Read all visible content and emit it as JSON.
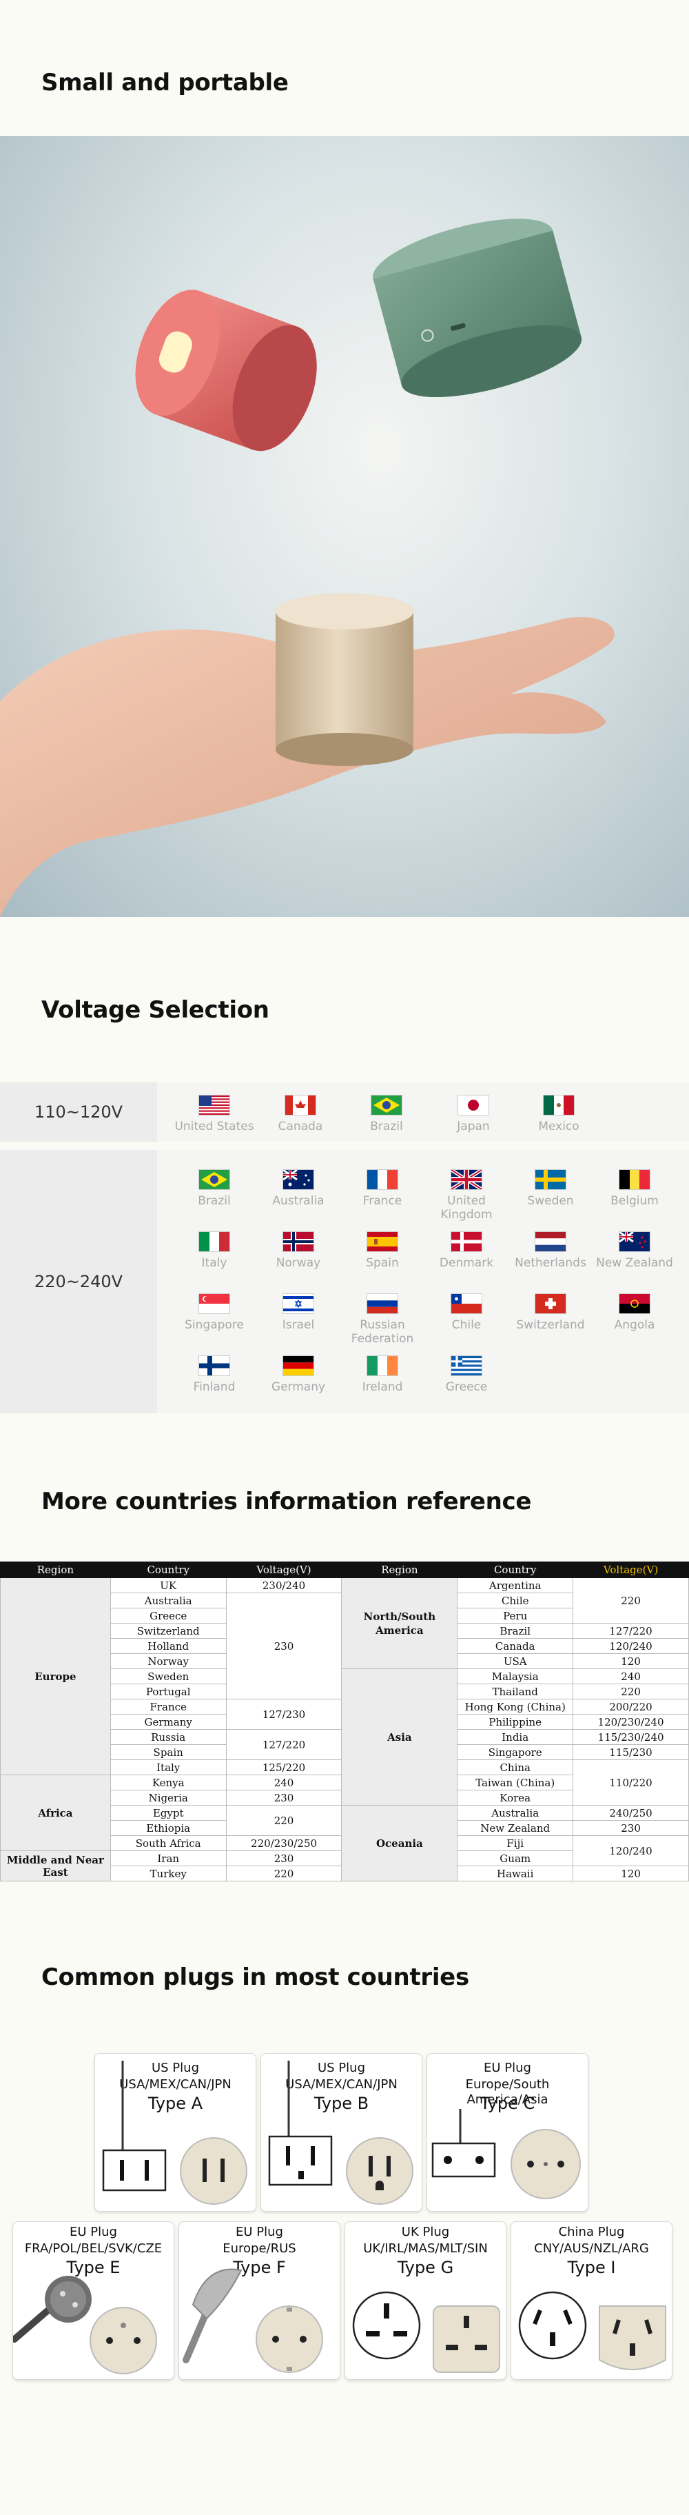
{
  "sections": {
    "portable_title": "Small and portable",
    "voltage_title": "Voltage Selection",
    "countries_title": "More countries information reference",
    "plugs_title": "Common plugs in most countries"
  },
  "voltage": {
    "row1": {
      "label": "110~120V",
      "countries": [
        "United States",
        "Canada",
        "Brazil",
        "Japan",
        "Mexico"
      ]
    },
    "row2": {
      "label": "220~240V",
      "countries": [
        [
          "Brazil",
          "Australia",
          "France",
          "United Kingdom",
          "Sweden",
          "Belgium"
        ],
        [
          "Italy",
          "Norway",
          "Spain",
          "Denmark",
          "Netherlands",
          "New Zealand"
        ],
        [
          "Singapore",
          "Israel",
          "Russian Federation",
          "Chile",
          "Switzerland",
          "Angola"
        ],
        [
          "Finland",
          "Germany",
          "Ireland",
          "Greece"
        ]
      ]
    }
  },
  "table": {
    "headers": [
      "Region",
      "Country",
      "Voltage(V)",
      "Region",
      "Country",
      "Voltage(V)"
    ],
    "left": {
      "europe": "Europe",
      "africa": "Africa",
      "middle_east": "Middle and Near East",
      "countries": [
        "UK",
        "Australia",
        "Greece",
        "Switzerland",
        "Holland",
        "Norway",
        "Sweden",
        "Portugal",
        "France",
        "Germany",
        "Russia",
        "Spain",
        "Italy",
        "Kenya",
        "Nigeria",
        "Egypt",
        "Ethiopia",
        "South Africa",
        "Iran",
        "Turkey"
      ],
      "voltages": {
        "uk": "230/240",
        "group1": "230",
        "group2": "127/230",
        "group3": "127/220",
        "italy": "125/220",
        "kenya": "240",
        "nigeria": "230",
        "group4": "220",
        "south_africa": "220/230/250",
        "iran": "230",
        "turkey": "220"
      }
    },
    "right": {
      "americas": "North/South America",
      "asia": "Asia",
      "oceania": "Oceania",
      "countries": [
        "Argentina",
        "Chile",
        "Peru",
        "Brazil",
        "Canada",
        "USA",
        "Malaysia",
        "Thailand",
        "Hong Kong (China)",
        "Philippine",
        "India",
        "Singapore",
        "China",
        "Taiwan (China)",
        "Korea",
        "Australia",
        "New Zealand",
        "Fiji",
        "Guam",
        "Hawaii"
      ],
      "voltages": {
        "group1": "220",
        "brazil": "127/220",
        "canada": "120/240",
        "usa": "120",
        "malaysia": "240",
        "thailand": "220",
        "hongkong": "200/220",
        "philippine": "120/230/240",
        "india": "115/230/240",
        "singapore": "115/230",
        "group2": "110/220",
        "australia": "240/250",
        "newzealand": "230",
        "group3": "120/240",
        "hawaii": "120"
      }
    }
  },
  "plugs": [
    {
      "line1": "US Plug",
      "line2": "USA/MEX/CAN/JPN",
      "type": "Type A"
    },
    {
      "line1": "US Plug",
      "line2": "USA/MEX/CAN/JPN",
      "type": "Type B"
    },
    {
      "line1": "EU Plug",
      "line2": "Europe/South America/Asia",
      "type": "Type C"
    },
    {
      "line1": "EU Plug",
      "line2": "FRA/POL/BEL/SVK/CZE",
      "type": "Type E"
    },
    {
      "line1": "EU Plug",
      "line2": "Europe/RUS",
      "type": "Type F"
    },
    {
      "line1": "UK Plug",
      "line2": "UK/IRL/MAS/MLT/SIN",
      "type": "Type G"
    },
    {
      "line1": "China Plug",
      "line2": "CNY/AUS/NZL/ARG",
      "type": "Type I"
    }
  ],
  "colors": {
    "background": "#fbfbf5",
    "table_header": "#111111",
    "voltage_header_accent": "#f2c200"
  }
}
